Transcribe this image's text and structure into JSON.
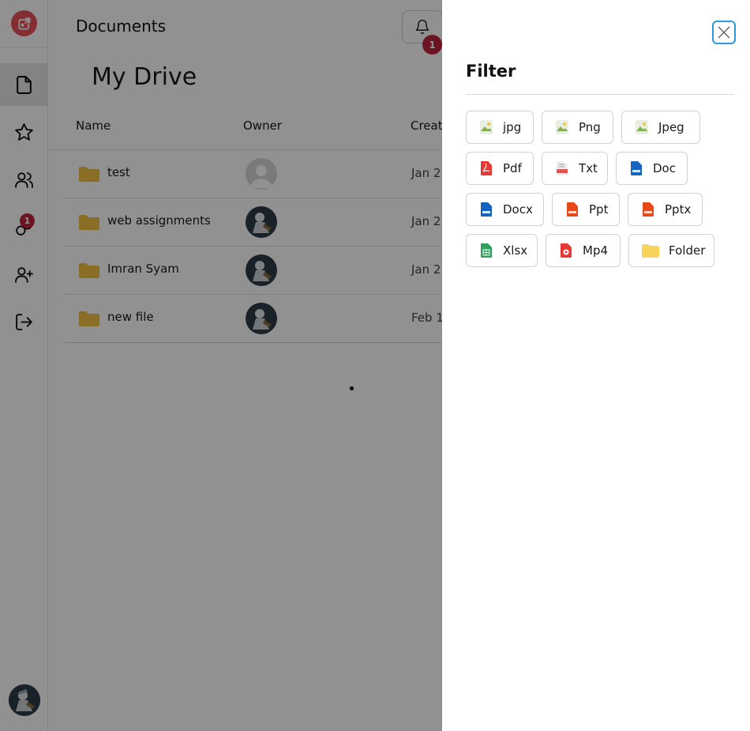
{
  "sidebar": {
    "items": [
      {
        "name": "documents",
        "icon": "document-icon",
        "active": true
      },
      {
        "name": "starred",
        "icon": "star-icon"
      },
      {
        "name": "shared",
        "icon": "users-icon"
      },
      {
        "name": "requests",
        "icon": "share-requests-icon",
        "badge": "1"
      },
      {
        "name": "add-user",
        "icon": "user-plus-icon"
      },
      {
        "name": "logout",
        "icon": "logout-icon"
      }
    ]
  },
  "header": {
    "title": "Documents",
    "notification_count": "1"
  },
  "main": {
    "title": "My Drive",
    "columns": [
      "Name",
      "Owner",
      "Creat"
    ],
    "rows": [
      {
        "name": "test",
        "owner": "default-avatar",
        "created": "Jan 2"
      },
      {
        "name": "web assignments",
        "owner": "user-avatar",
        "created": "Jan 2"
      },
      {
        "name": "Imran Syam",
        "owner": "user-avatar",
        "created": "Jan 2"
      },
      {
        "name": "new file",
        "owner": "user-avatar",
        "created": "Feb 1,"
      }
    ]
  },
  "filter": {
    "title": "Filter",
    "chips": [
      {
        "label": "jpg",
        "icon": "image-file-icon"
      },
      {
        "label": "Png",
        "icon": "image-file-icon"
      },
      {
        "label": "Jpeg",
        "icon": "image-file-icon"
      },
      {
        "label": "Pdf",
        "icon": "pdf-icon"
      },
      {
        "label": "Txt",
        "icon": "txt-file-icon"
      },
      {
        "label": "Doc",
        "icon": "doc-file-icon"
      },
      {
        "label": "Docx",
        "icon": "doc-file-icon"
      },
      {
        "label": "Ppt",
        "icon": "ppt-file-icon"
      },
      {
        "label": "Pptx",
        "icon": "ppt-file-icon"
      },
      {
        "label": "Xlsx",
        "icon": "sheet-file-icon"
      },
      {
        "label": "Mp4",
        "icon": "video-file-icon"
      },
      {
        "label": "Folder",
        "icon": "folder-icon"
      }
    ]
  },
  "colors": {
    "accent_red": "#c0243f",
    "logo_red": "#e8505b",
    "close_blue": "#2b9bd6",
    "folder_yellow": "#f5c242"
  }
}
